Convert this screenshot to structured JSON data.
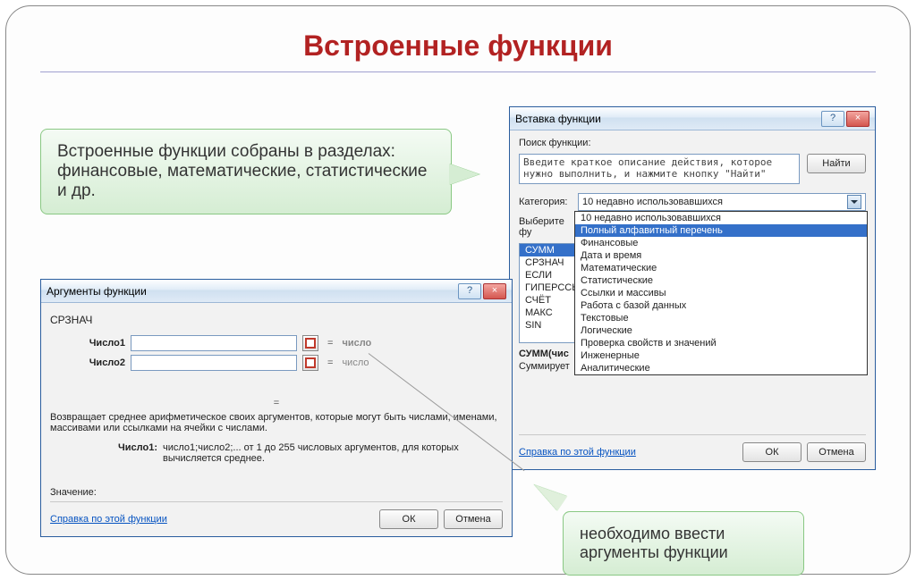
{
  "slide": {
    "title": "Встроенные функции"
  },
  "callouts": {
    "top": "Встроенные функции собраны в разделах: финансовые, математические, статистические и др.",
    "bottom": "необходимо ввести аргументы функции"
  },
  "insertFn": {
    "title": "Вставка функции",
    "help_icon": "?",
    "close_icon": "×",
    "search_label": "Поиск функции:",
    "search_placeholder": "Введите краткое описание действия, которое нужно выполнить, и нажмите кнопку \"Найти\"",
    "search_btn": "Найти",
    "category_label": "Категория:",
    "category_value": "10 недавно использовавшихся",
    "dropdown": {
      "selected_index": 1,
      "options": [
        "10 недавно использовавшихся",
        "Полный алфавитный перечень",
        "Финансовые",
        "Дата и время",
        "Математические",
        "Статистические",
        "Ссылки и массивы",
        "Работа с базой данных",
        "Текстовые",
        "Логические",
        "Проверка свойств и значений",
        "Инженерные",
        "Аналитические"
      ]
    },
    "select_label": "Выберите фу",
    "functions": [
      "СУММ",
      "СРЗНАЧ",
      "ЕСЛИ",
      "ГИПЕРССЫ",
      "СЧЁТ",
      "МАКС",
      "SIN"
    ],
    "selected_fn_index": 0,
    "fn_name": "СУММ(чис",
    "fn_desc": "Суммирует",
    "help_link": "Справка по этой функции",
    "ok": "ОК",
    "cancel": "Отмена"
  },
  "argsFn": {
    "title": "Аргументы функции",
    "help_icon": "?",
    "close_icon": "×",
    "fn": "СРЗНАЧ",
    "args": [
      {
        "label": "Число1",
        "hint": "число",
        "bold": true
      },
      {
        "label": "Число2",
        "hint": "число",
        "bold": false
      }
    ],
    "eq_sign": "=",
    "desc_center": "=",
    "desc": "Возвращает среднее арифметическое своих аргументов, которые могут быть числами, именами, массивами или ссылками на ячейки с числами.",
    "arg_key": "Число1:",
    "arg_val": "число1;число2;... от 1 до 255 числовых аргументов, для которых вычисляется среднее.",
    "value_label": "Значение:",
    "help_link": "Справка по этой функции",
    "ok": "ОК",
    "cancel": "Отмена"
  }
}
